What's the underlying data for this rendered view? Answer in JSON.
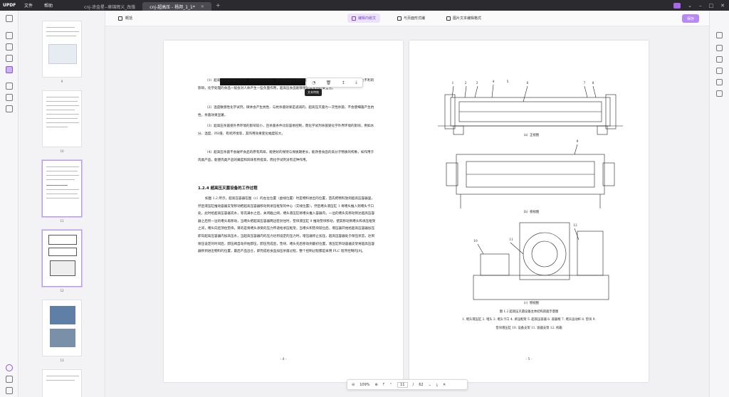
{
  "titlebar": {
    "logo": "UPDF",
    "menu": [
      "文件",
      "帮助"
    ],
    "tabs": [
      {
        "label": "cnj-涂金星--章锦辉义_改版",
        "active": false
      },
      {
        "label": "cnj-超高压 - 杨邦_1_1*",
        "active": true
      }
    ],
    "add_tab": "+",
    "win_controls": [
      "⌄",
      "–",
      "□",
      "✕"
    ]
  },
  "toolbar": {
    "panel_label": "概括",
    "modes": [
      {
        "label": "编辑内嵌文",
        "active": true
      },
      {
        "label": "与页面形式编",
        "active": false
      },
      {
        "label": "图片文本编辑格式",
        "active": false
      }
    ],
    "save_label": "保存"
  },
  "thumbnails": [
    {
      "number": "9",
      "selected": false
    },
    {
      "number": "10",
      "selected": false
    },
    {
      "number": "11",
      "selected": true
    },
    {
      "number": "12",
      "selected": true
    },
    {
      "number": "13",
      "selected": false
    }
  ],
  "edit_bar": {
    "buttons": [
      "◔",
      "🗑",
      "↥",
      "⤓"
    ],
    "tooltip": "文本特效"
  },
  "left_page": {
    "paragraphs": [
      "（1）超高压杀菌的安全性高，已有的科学实验，学试剂与微生物细胞内物质作用生成的产物一般会对人体产生不利的影响，化学处理的食品一般会对人体产生一些负面作用，超高压食品能够保证其食用的安全性。",
      "（2）温度敏感性化学试剂，微体会产生抗性、与抗杀菌效果是递减的，超高压灭菌为一次性杀菌，不会使细菌产生抗性，杀菌效果显著。",
      "（3）超高压杀菌受外界环境的影响较小，且杀菌条件比较容易控制，而化学试剂杀菌受化学外界环境的影响，例如水分、温度、PH值、有机环境等，其作用效果变化幅度较大。",
      "（4）超高压杀菌不会破坏食品的原有风味，能更好的保持与保质期更长，能改善食品的高分子物质的构象，如作用于肉类产品，能使肉类产品的嫩度和风味有所提高，而化学试剂没有这种作用。"
    ],
    "heading": "1.2.4 超高压灭菌设备的工作过程",
    "body": "如图 1.2 所示，超高压容器在图（c）的左位位置（虚线位置）时是物料进出的位置，首先把物料放到超高压容器里，然后液压缸推动容器支架移动把超高压容器移动到承压框架的中心（实线位置），然后堵头液压缸 1 将堵头推入到堵头卡口处，此时给超高压容器充水，等充满水之后，关闭截止阀，堵头液压缸将堵头推入容器内，一边的堵头先移动到达超高压容器之后另一边的堵头再移动，当堵头把超高压容器两边密封住时，垫块液压缸 9 推动垫块移动，使其移动到堵头和承压框架之间，堵头向后顶住垫块，目的是将堵头承受的压力传递给承压框架，当堵头和垫块就位后，增压器开始给超高压容器加压即向超高压容器内加高压水，当超高压容器内的压力达到设定的压力时，增压器停止加压，超高压容器处于保压状态，达到保压设定的时间后，卸压阀自动开始卸压，卸压完成后，垫块、堵头先后移动到最初位置，液压缸带动容器支架将超高压容器移到进出物料的位置，最后产品出仓，即完成给食品加压杀菌过程，整个控制过程都是采用 PLC 程序控制的[9]。",
    "page_number": "- 4 -"
  },
  "right_page": {
    "callouts_top": [
      "1",
      "2",
      "3",
      "4",
      "5",
      "6",
      "7",
      "8"
    ],
    "caption_a": "（a）正视图",
    "callout_b": "9",
    "caption_b": "（b）俯视图",
    "callouts_c": [
      "10",
      "11",
      "12"
    ],
    "caption_c": "（c）侧视图",
    "figure_title": "图 1.2 超高压灭菌设备主体结构剖面示意图",
    "legend_line1": "1. 堵头液压缸 2. 堵头 3. 堵头卡口 4. 承压框架 5. 超高压容器 6. 容器框 7. 堵头运动杆 8. 垫块 9.",
    "legend_line2": "垫块液压缸 10. 设备支架 11. 容器支架 12. 机箱",
    "page_number": "- 5 -"
  },
  "navbar": {
    "zoom_out": "⊖",
    "zoom": "109%",
    "zoom_in": "⊕",
    "first": "⤒",
    "prev": "⌃",
    "page": "11",
    "sep": "/",
    "total": "62",
    "next": "⌄",
    "last": "⤓",
    "close": "✕"
  }
}
